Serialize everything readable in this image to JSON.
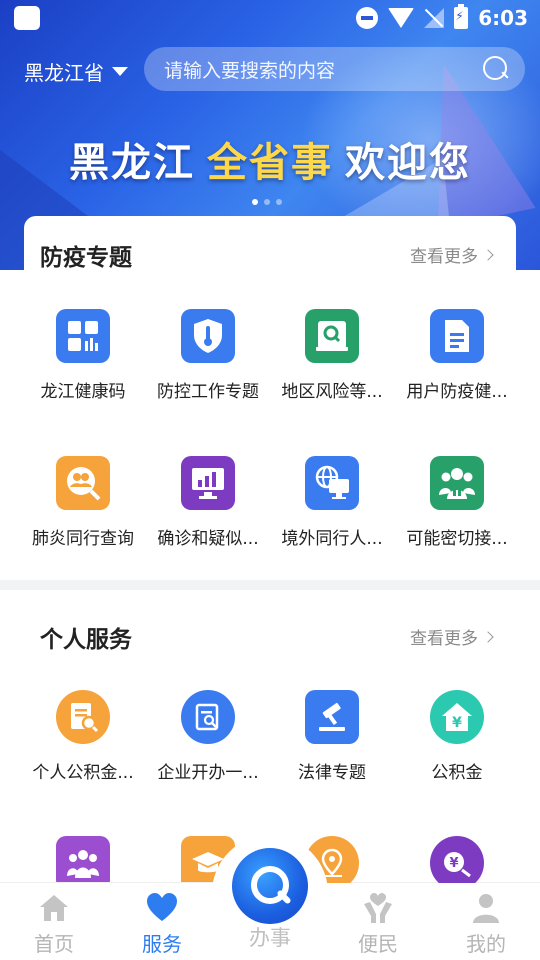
{
  "status_bar": {
    "time": "6:03"
  },
  "header": {
    "location": "黑龙江省",
    "search_placeholder": "请输入要搜索的内容"
  },
  "banner": {
    "slogan_part1": "黑龙江",
    "slogan_part2": "全省事",
    "slogan_part3": "欢迎您",
    "highlight_color": "#ffd84a"
  },
  "epidemic": {
    "title": "防疫专题",
    "more": "查看更多",
    "items": [
      {
        "label": "龙江健康码",
        "icon": "grid-qr-icon",
        "color": "#3a7cf0"
      },
      {
        "label": "防控工作专题",
        "icon": "thermometer-shield-icon",
        "color": "#3a7cf0"
      },
      {
        "label": "地区风险等...",
        "icon": "search-book-icon",
        "color": "#27a06a"
      },
      {
        "label": "用户防疫健...",
        "icon": "document-icon",
        "color": "#3a7cf0"
      },
      {
        "label": "肺炎同行查询",
        "icon": "people-search-icon",
        "color": "#f5a33a"
      },
      {
        "label": "确诊和疑似...",
        "icon": "bar-chart-monitor-icon",
        "color": "#7d3bc2"
      },
      {
        "label": "境外同行人...",
        "icon": "globe-computer-icon",
        "color": "#3a7cf0"
      },
      {
        "label": "可能密切接...",
        "icon": "people-lungs-icon",
        "color": "#27a06a"
      }
    ]
  },
  "personal": {
    "title": "个人服务",
    "more": "查看更多",
    "items": [
      {
        "label": "个人公积金...",
        "icon": "fund-document-icon",
        "color": "#f5a33a"
      },
      {
        "label": "企业开办一...",
        "icon": "document-search-icon",
        "color": "#3a7cf0"
      },
      {
        "label": "法律专题",
        "icon": "gavel-icon",
        "color": "#3a7cf0"
      },
      {
        "label": "公积金",
        "icon": "house-yen-icon",
        "color": "#2bc9b0"
      },
      {
        "label": "",
        "icon": "family-icon",
        "color": "#9b4ed0"
      },
      {
        "label": "",
        "icon": "graduation-cap-icon",
        "color": "#f5a33a"
      },
      {
        "label": "",
        "icon": "location-pen-icon",
        "color": "#f5a33a"
      },
      {
        "label": "",
        "icon": "yen-search-icon",
        "color": "#7d3bc2"
      }
    ]
  },
  "bottom_nav": {
    "items": [
      {
        "label": "首页",
        "icon": "home-icon"
      },
      {
        "label": "服务",
        "icon": "heart-icon"
      },
      {
        "label": "办事",
        "icon": "search-q-icon"
      },
      {
        "label": "便民",
        "icon": "hands-heart-icon"
      },
      {
        "label": "我的",
        "icon": "person-icon"
      }
    ],
    "active_color": "#2e7df0"
  }
}
